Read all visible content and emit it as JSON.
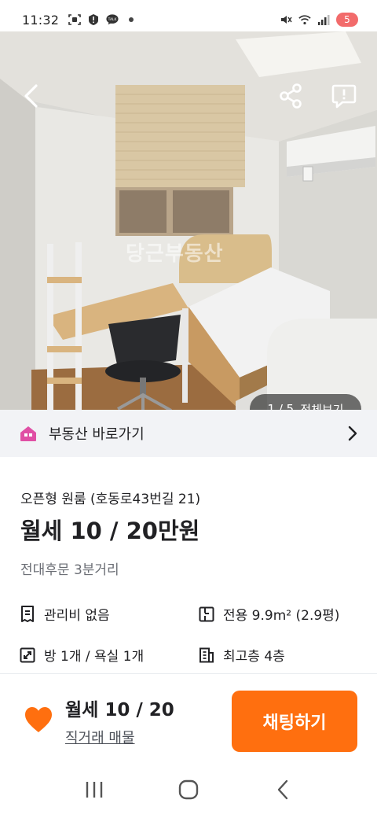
{
  "status": {
    "time": "11:32",
    "left_icons": [
      "screenshot-icon",
      "alert-icon",
      "kakaotalk-icon",
      "dot-icon"
    ],
    "right_icons": [
      "mute-icon",
      "wifi-icon",
      "signal-icon"
    ],
    "battery": "5"
  },
  "photo": {
    "watermark": "당근부동산",
    "counter": "1 / 5",
    "view_all": "전체보기"
  },
  "shortcut": {
    "label": "부동산 바로가기"
  },
  "listing": {
    "subtitle": "오픈형 원룸 (호동로43번길 21)",
    "price_title": "월세 10 / 20만원",
    "location": "전대후문 3분거리",
    "maintenance": "관리비 없음",
    "area": "전용 9.9m² (2.9평)",
    "rooms": "방 1개 / 욕실 1개",
    "floor": "최고층 4층"
  },
  "bottom_bar": {
    "price": "월세 10 / 20",
    "deal_type": "직거래 매물",
    "chat_button": "채팅하기"
  },
  "colors": {
    "accent": "#ff6f0f",
    "shortcut_icon": "#e04fa5",
    "battery": "#f26b6b"
  }
}
